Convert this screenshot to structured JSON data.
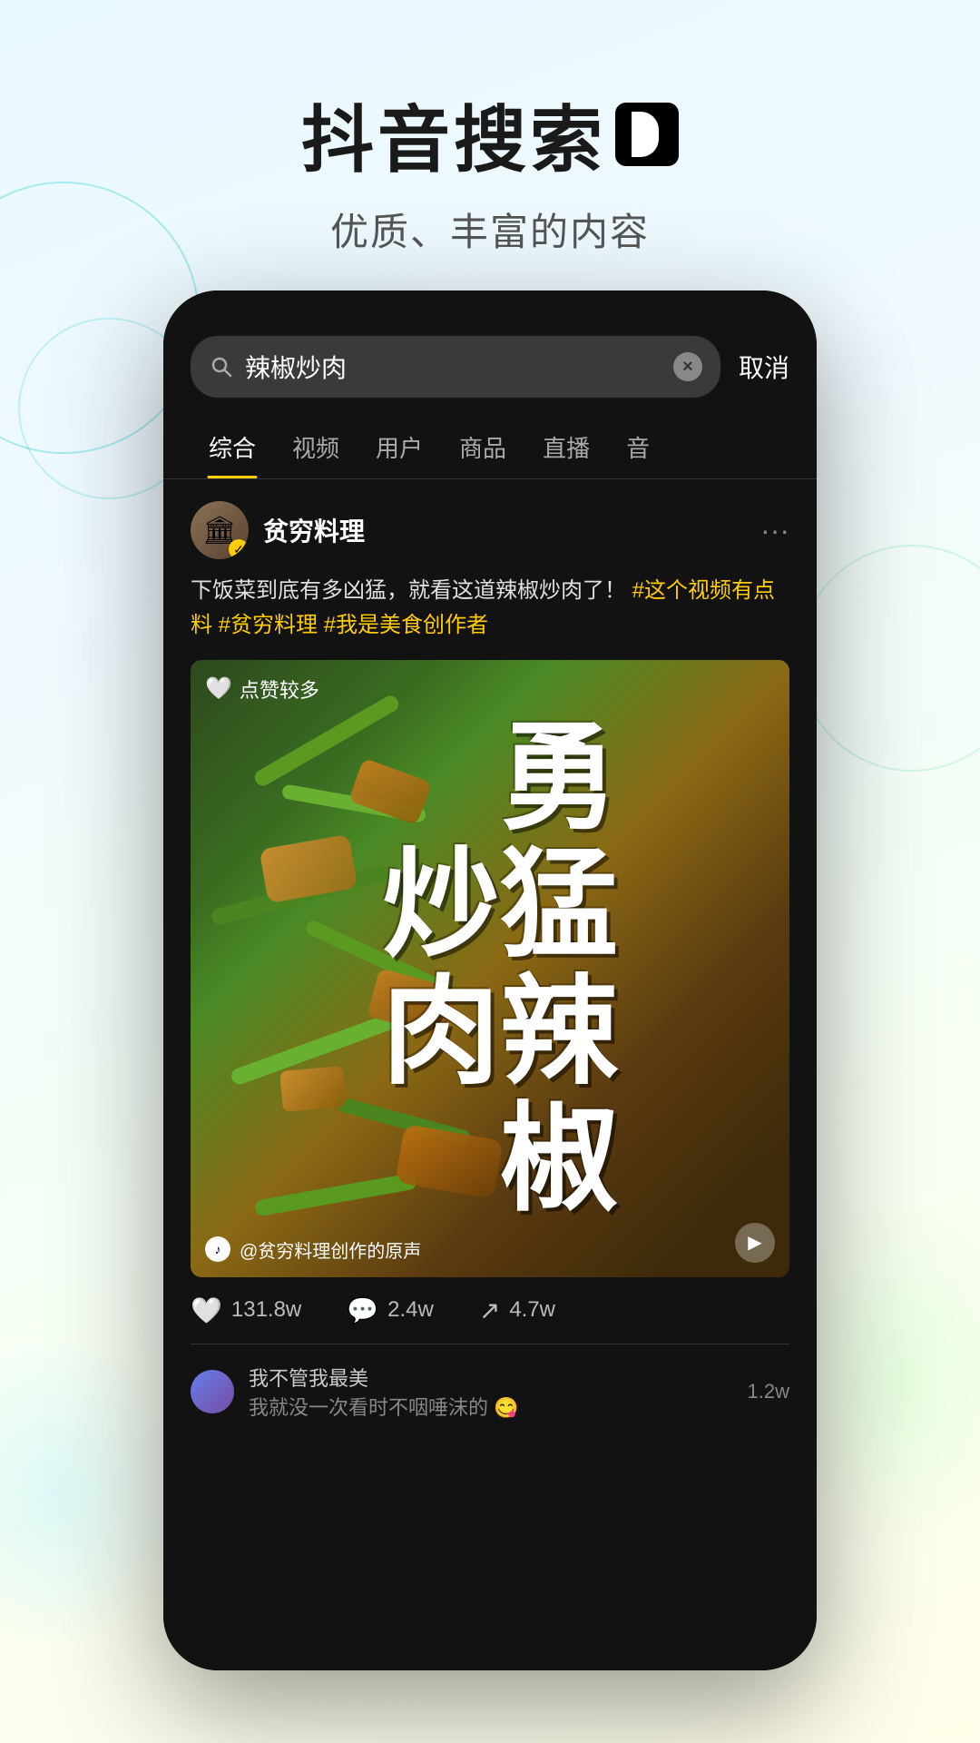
{
  "header": {
    "title": "抖音搜索",
    "logo_icon": "♪",
    "subtitle": "优质、丰富的内容"
  },
  "search": {
    "query": "辣椒炒肉",
    "cancel_label": "取消",
    "clear_icon": "×"
  },
  "tabs": [
    {
      "label": "综合",
      "active": true
    },
    {
      "label": "视频",
      "active": false
    },
    {
      "label": "用户",
      "active": false
    },
    {
      "label": "商品",
      "active": false
    },
    {
      "label": "直播",
      "active": false
    },
    {
      "label": "音",
      "active": false
    }
  ],
  "post": {
    "user_name": "贫穷料理",
    "description": "下饭菜到底有多凶猛，就看这道辣椒炒肉了！",
    "hashtags": [
      "#这个视频有点料",
      "#贫穷料理",
      "#我是美食创作者"
    ],
    "likes_badge": "点赞较多",
    "video_title": "勇猛辣椒炒肉",
    "sound_text": "@贫穷料理创作的原声",
    "stats": {
      "likes": "131.8w",
      "comments": "2.4w",
      "shares": "4.7w"
    }
  },
  "comments": [
    {
      "username": "我不管我最美",
      "text": "我就没一次看时不咽唾沫的 😋",
      "count": "1.2w"
    }
  ],
  "colors": {
    "accent": "#FFCC00",
    "background": "#121212",
    "text_primary": "#ffffff",
    "text_secondary": "#aaaaaa",
    "hashtag": "#FFCC00"
  }
}
